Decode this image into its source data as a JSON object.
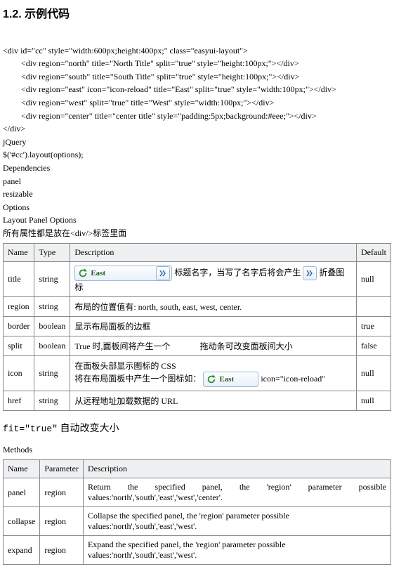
{
  "heading": "1.2. 示例代码",
  "code": {
    "l1": "<div id=\"cc\" style=\"width:600px;height:400px;\" class=\"easyui-layout\">",
    "l2": "<div region=\"north\" title=\"North Title\" split=\"true\" style=\"height:100px;\"></div>",
    "l3": "<div region=\"south\" title=\"South Title\" split=\"true\" style=\"height:100px;\"></div>",
    "l4": "<div region=\"east\" icon=\"icon-reload\" title=\"East\" split=\"true\" style=\"width:100px;\"></div>",
    "l5": "<div region=\"west\" split=\"true\" title=\"West\" style=\"width:100px;\"></div>",
    "l6": "<div region=\"center\" title=\"center title\" style=\"padding:5px;background:#eee;\"></div>",
    "l7": "</div>"
  },
  "jq": {
    "l1": "jQuery",
    "l2": "$('#cc').layout(options);",
    "dep": "Dependencies",
    "panel": "panel",
    "resizable": "resizable",
    "opts": "Options",
    "lpo": "Layout Panel Options",
    "note": "所有属性都是放在<div/>标签里面"
  },
  "opt_headers": {
    "name": "Name",
    "type": "Type",
    "desc": "Description",
    "def": "Default"
  },
  "options": {
    "title": {
      "name": "title",
      "type": "string",
      "def": "null",
      "east_label": "East",
      "desc_mid": "标题名字，当写了名字后将会产生",
      "desc_tail": "折叠图标"
    },
    "region": {
      "name": "region",
      "type": "string",
      "def": "",
      "desc": "布局的位置值有: north, south, east, west, center."
    },
    "border": {
      "name": "border",
      "type": "boolean",
      "def": "true",
      "desc": "显示布局面板的边框"
    },
    "split": {
      "name": "split",
      "type": "boolean",
      "def": "false",
      "p1": "True 时,面板间将产生一个",
      "p2": "拖动条可改变面板间大小"
    },
    "icon": {
      "name": "icon",
      "type": "string",
      "def": "null",
      "line1": "在面板头部显示图标的 CSS",
      "line2a": "将在布局面板中产生一个图标如：",
      "east_label": "East",
      "line2b": "icon=\"icon-reload\""
    },
    "href": {
      "name": "href",
      "type": "string",
      "def": "null",
      "desc": "从远程地址加载数据的 URL"
    }
  },
  "fit": {
    "code": "fit=\"true\"",
    "text": " 自动改变大小"
  },
  "methods_label": "Methods",
  "meth_headers": {
    "name": "Name",
    "param": "Parameter",
    "desc": "Description"
  },
  "methods": {
    "panel": {
      "name": "panel",
      "param": "region",
      "d1": "Return the specified panel, the 'region' parameter possible",
      "d2": "values:'north','south','east','west','center'."
    },
    "collapse": {
      "name": "collapse",
      "param": "region",
      "desc": "Collapse the specified panel, the 'region' parameter possible values:'north','south','east','west'."
    },
    "expand": {
      "name": "expand",
      "param": "region",
      "desc": "Expand the specified panel, the 'region' parameter possible values:'north','south','east','west'."
    }
  }
}
